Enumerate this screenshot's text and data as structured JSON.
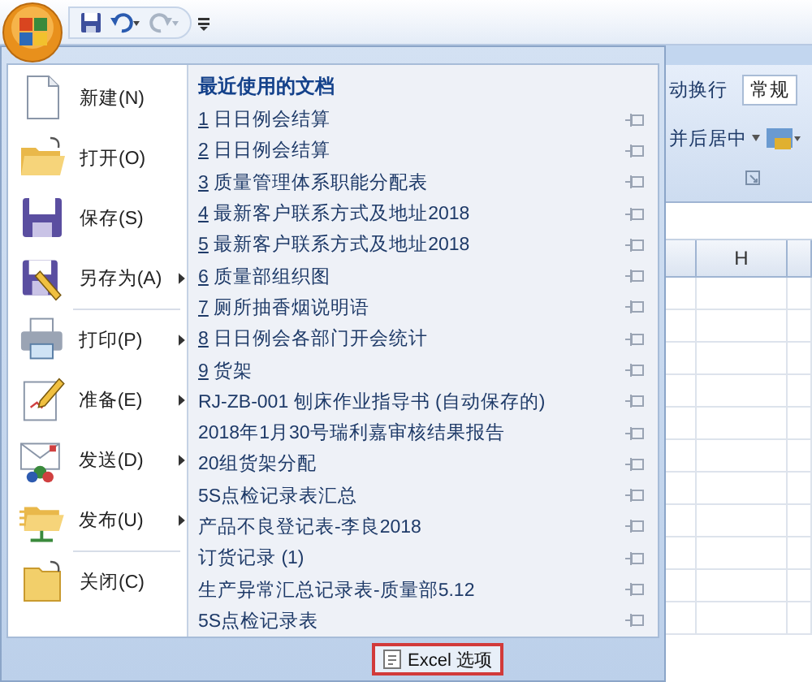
{
  "quick_access": {
    "undo_enabled": true,
    "redo_enabled": false
  },
  "office_menu": {
    "commands": [
      {
        "label": "新建(N)",
        "has_submenu": false,
        "separator_after": false
      },
      {
        "label": "打开(O)",
        "has_submenu": false,
        "separator_after": false
      },
      {
        "label": "保存(S)",
        "has_submenu": false,
        "separator_after": false
      },
      {
        "label": "另存为(A)",
        "has_submenu": true,
        "separator_after": true
      },
      {
        "label": "打印(P)",
        "has_submenu": true,
        "separator_after": false
      },
      {
        "label": "准备(E)",
        "has_submenu": true,
        "separator_after": false
      },
      {
        "label": "发送(D)",
        "has_submenu": true,
        "separator_after": false
      },
      {
        "label": "发布(U)",
        "has_submenu": true,
        "separator_after": true
      },
      {
        "label": "关闭(C)",
        "has_submenu": false,
        "separator_after": false
      }
    ],
    "recent_title": "最近使用的文档",
    "recent_documents": [
      {
        "number": "1",
        "name": "日日例会结算",
        "pinned": false
      },
      {
        "number": "2",
        "name": "日日例会结算",
        "pinned": false
      },
      {
        "number": "3",
        "name": "质量管理体系职能分配表",
        "pinned": false
      },
      {
        "number": "4",
        "name": "最新客户联系方式及地址2018",
        "pinned": false
      },
      {
        "number": "5",
        "name": "最新客户联系方式及地址2018",
        "pinned": false
      },
      {
        "number": "6",
        "name": "质量部组织图",
        "pinned": false
      },
      {
        "number": "7",
        "name": "厕所抽香烟说明语",
        "pinned": false
      },
      {
        "number": "8",
        "name": "日日例会各部门开会统计",
        "pinned": false
      },
      {
        "number": "9",
        "name": "货架",
        "pinned": false
      },
      {
        "name": "RJ-ZB-001 刨床作业指导书 (自动保存的)",
        "pinned": false
      },
      {
        "name": "2018年1月30号瑞利嘉审核结果报告",
        "pinned": false
      },
      {
        "name": "20组货架分配",
        "pinned": false
      },
      {
        "name": "5S点检记录表汇总",
        "pinned": false
      },
      {
        "name": "产品不良登记表-李良2018",
        "pinned": false
      },
      {
        "name": "订货记录 (1)",
        "pinned": false
      },
      {
        "name": "生产异常汇总记录表-质量部5.12",
        "pinned": false
      },
      {
        "name": "5S点检记录表",
        "pinned": false
      }
    ],
    "footer_buttons": [
      {
        "label": "Excel 选项",
        "highlighted": true
      }
    ]
  },
  "ribbon": {
    "wrap_text": "动换行",
    "merge_center": "并后居中",
    "number_format": "常规"
  },
  "sheet": {
    "column_header": "H"
  }
}
